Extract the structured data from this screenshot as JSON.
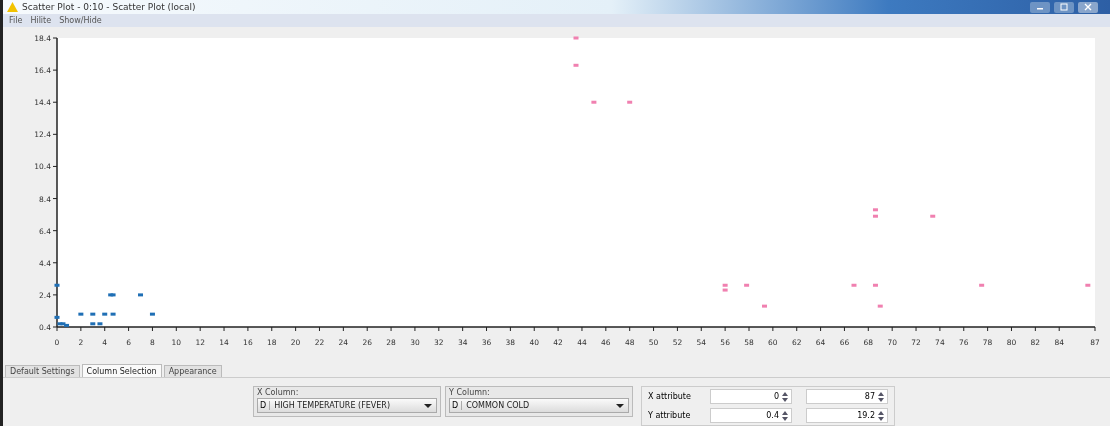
{
  "window": {
    "title": "Scatter Plot - 0:10 - Scatter Plot (local)"
  },
  "menu": [
    "File",
    "Hilite",
    "Show/Hide"
  ],
  "plot": {
    "chart_data": {
      "type": "scatter",
      "xlim": [
        0,
        87
      ],
      "ylim": [
        0.4,
        18.4
      ],
      "xticks": [
        0,
        2,
        4,
        6,
        8,
        10,
        12,
        14,
        16,
        18,
        20,
        22,
        24,
        26,
        28,
        30,
        32,
        34,
        36,
        38,
        40,
        42,
        44,
        46,
        48,
        50,
        52,
        54,
        56,
        58,
        60,
        62,
        64,
        66,
        68,
        70,
        72,
        74,
        76,
        78,
        80,
        82,
        84,
        87
      ],
      "yticks": [
        0.4,
        2.4,
        4.4,
        6.4,
        8.4,
        10.4,
        12.4,
        14.4,
        16.4,
        18.4
      ],
      "series": [
        {
          "color": "#1f6fb5",
          "x": [
            0,
            0,
            0.25,
            0.5,
            0.8,
            2,
            3,
            3,
            3.6,
            4,
            4.5,
            4.7,
            4.7,
            7,
            8
          ],
          "values": [
            3.0,
            1.0,
            0.6,
            0.6,
            0.5,
            1.2,
            1.2,
            0.6,
            0.6,
            1.2,
            2.4,
            2.4,
            1.2,
            2.4,
            1.2
          ]
        },
        {
          "color": "#f080b0",
          "x": [
            43.5,
            43.5,
            45,
            48,
            56,
            56,
            57.8,
            59.3,
            66.8,
            68.6,
            68.6,
            68.6,
            69,
            73.4,
            77.5,
            86.4
          ],
          "values": [
            18.4,
            16.7,
            14.4,
            14.4,
            3.0,
            2.7,
            3.0,
            1.7,
            3.0,
            3.0,
            7.7,
            7.3,
            1.7,
            7.3,
            3.0,
            3.0
          ]
        }
      ]
    }
  },
  "tabs": [
    {
      "label": "Default Settings",
      "selected": false
    },
    {
      "label": "Column Selection",
      "selected": true
    },
    {
      "label": "Appearance",
      "selected": false
    }
  ],
  "x_column": {
    "label": "X Column:",
    "type_badge": "D",
    "value": "HIGH TEMPERATURE (FEVER)"
  },
  "y_column": {
    "label": "Y Column:",
    "type_badge": "D",
    "value": "COMMON COLD"
  },
  "attributes": [
    {
      "label": "X attribute",
      "min": "0",
      "max": "87"
    },
    {
      "label": "Y attribute",
      "min": "0.4",
      "max": "19.2"
    }
  ]
}
